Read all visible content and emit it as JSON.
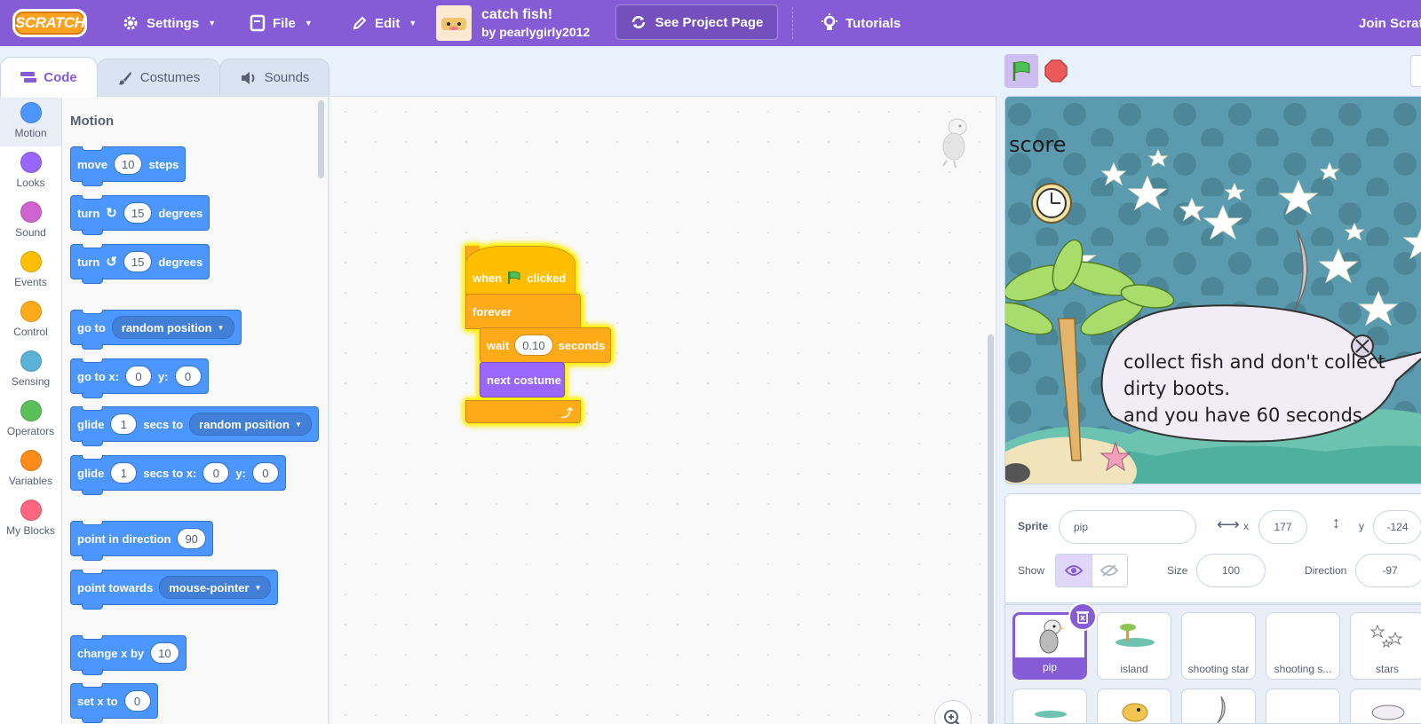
{
  "menu": {
    "logo": "SCRATCH",
    "settings": "Settings",
    "file": "File",
    "edit": "Edit",
    "project_title": "catch fish!",
    "project_author": "by pearlygirly2012",
    "see_project_page": "See Project Page",
    "tutorials": "Tutorials",
    "join": "Join Scratch"
  },
  "tabs": {
    "code": "Code",
    "costumes": "Costumes",
    "sounds": "Sounds"
  },
  "categories": [
    {
      "label": "Motion",
      "color": "#4c97ff"
    },
    {
      "label": "Looks",
      "color": "#9966ff"
    },
    {
      "label": "Sound",
      "color": "#cf63cf"
    },
    {
      "label": "Events",
      "color": "#ffbf00"
    },
    {
      "label": "Control",
      "color": "#ffab19"
    },
    {
      "label": "Sensing",
      "color": "#5cb1d6"
    },
    {
      "label": "Operators",
      "color": "#59c059"
    },
    {
      "label": "Variables",
      "color": "#ff8c1a"
    },
    {
      "label": "My Blocks",
      "color": "#ff6680"
    }
  ],
  "palette": {
    "heading": "Motion",
    "move": {
      "a": "move",
      "v": "10",
      "b": "steps"
    },
    "turn_right": {
      "a": "turn",
      "v": "15",
      "b": "degrees"
    },
    "turn_left": {
      "a": "turn",
      "v": "15",
      "b": "degrees"
    },
    "goto": {
      "a": "go to",
      "menu": "random position"
    },
    "goto_xy": {
      "a": "go to x:",
      "x": "0",
      "b": "y:",
      "y": "0"
    },
    "glide": {
      "a": "glide",
      "v": "1",
      "b": "secs to",
      "menu": "random position"
    },
    "glide_xy": {
      "a": "glide",
      "v": "1",
      "b": "secs to x:",
      "x": "0",
      "c": "y:",
      "y": "0"
    },
    "point_dir": {
      "a": "point in direction",
      "v": "90"
    },
    "point_towards": {
      "a": "point towards",
      "menu": "mouse-pointer"
    },
    "change_x": {
      "a": "change x by",
      "v": "10"
    },
    "set_x": {
      "a": "set x to",
      "v": "0"
    }
  },
  "script": {
    "when": "when",
    "clicked": "clicked",
    "forever": "forever",
    "wait": "wait",
    "wait_value": "0.10",
    "seconds": "seconds",
    "next_costume": "next costume"
  },
  "stage": {
    "score_label": "score",
    "bubble_line1": "collect fish and don't collect",
    "bubble_line2": "dirty boots.",
    "bubble_line3": " and you have 60 seconds"
  },
  "sprite_info": {
    "sprite_label": "Sprite",
    "sprite_name": "pip",
    "x_label": "x",
    "x_value": "177",
    "y_label": "y",
    "y_value": "-124",
    "show_label": "Show",
    "size_label": "Size",
    "size_value": "100",
    "direction_label": "Direction",
    "direction_value": "-97"
  },
  "sprites": [
    {
      "name": "pip",
      "selected": true
    },
    {
      "name": "island"
    },
    {
      "name": "shooting star"
    },
    {
      "name": "shooting s..."
    },
    {
      "name": "stars"
    }
  ],
  "colors": {
    "menu_bar": "#855cd6",
    "motion": "#4c97ff",
    "events": "#ffbf00",
    "control": "#ffab19",
    "looks": "#9966ff"
  }
}
